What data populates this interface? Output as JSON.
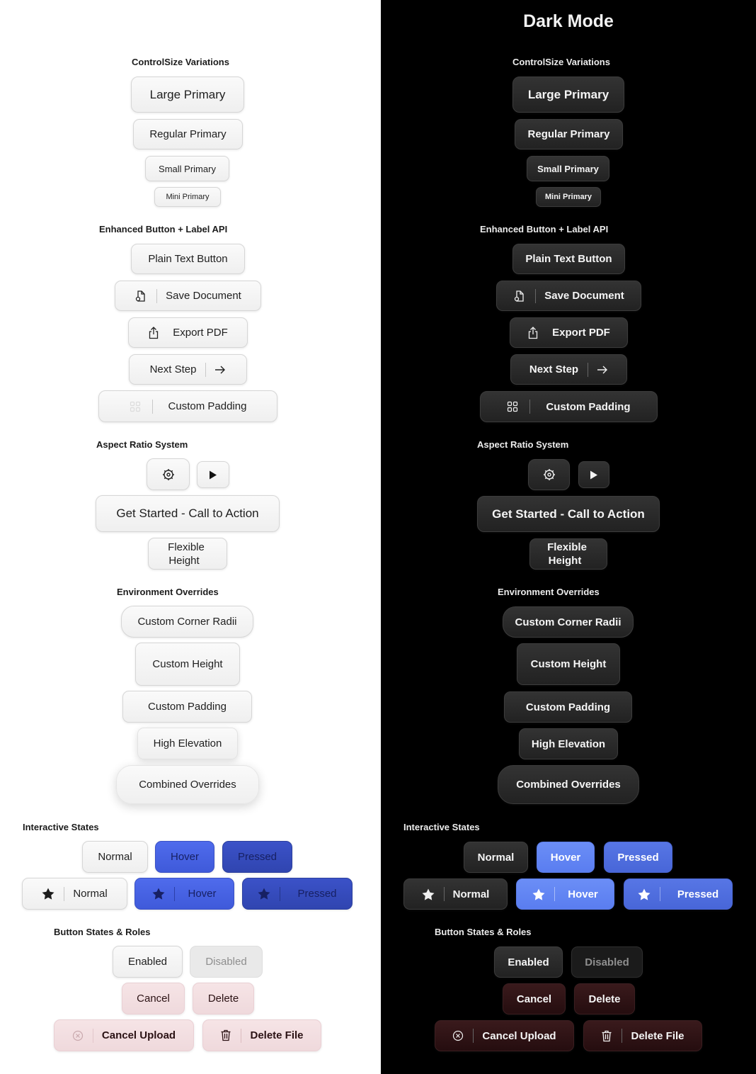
{
  "dark_panel": {
    "title": "Dark Mode"
  },
  "sections": {
    "control_size": "ControlSize Variations",
    "enhanced": "Enhanced Button + Label API",
    "aspect": "Aspect Ratio System",
    "environment": "Environment Overrides",
    "interactive": "Interactive States",
    "roles": "Button States & Roles"
  },
  "control_size": {
    "large": "Large Primary",
    "regular": "Regular Primary",
    "small": "Small Primary",
    "mini": "Mini Primary"
  },
  "enhanced": {
    "plain": "Plain Text Button",
    "save": "Save Document",
    "export": "Export PDF",
    "next": "Next Step",
    "padding": "Custom Padding"
  },
  "aspect": {
    "cta": "Get Started - Call to Action",
    "flex_line1": "Flexible",
    "flex_line2": "Height"
  },
  "environment": {
    "radii": "Custom Corner Radii",
    "height": "Custom Height",
    "padding": "Custom Padding",
    "elevation": "High Elevation",
    "combined": "Combined Overrides"
  },
  "interactive": {
    "normal": "Normal",
    "hover": "Hover",
    "pressed": "Pressed"
  },
  "roles": {
    "enabled": "Enabled",
    "disabled": "Disabled",
    "cancel": "Cancel",
    "delete": "Delete",
    "cancel_upload": "Cancel Upload",
    "delete_file": "Delete File"
  },
  "icons": [
    "document-icon",
    "share-icon",
    "arrow-right-icon",
    "grid-icon",
    "gear-icon",
    "play-icon",
    "star-icon",
    "xmark-circle-icon",
    "trash-icon"
  ],
  "colors": {
    "hover_light": "#4f6bec",
    "pressed_light": "#3b52c8",
    "hover_dark": "#6b8ef6",
    "pressed_dark": "#5776e5",
    "destructive_light": "#f6e4e6",
    "destructive_dark": "#3a1a1c"
  }
}
